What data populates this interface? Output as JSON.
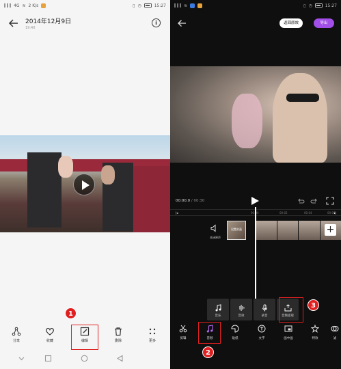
{
  "left": {
    "status": {
      "network": "4G",
      "speed": "2 K/s",
      "time": "15:27"
    },
    "header": {
      "date": "2014年12月9日",
      "time": "19:40"
    },
    "toolbar": [
      {
        "label": "分享",
        "icon": "share-icon"
      },
      {
        "label": "收藏",
        "icon": "heart-icon"
      },
      {
        "label": "编辑",
        "icon": "edit-icon"
      },
      {
        "label": "删除",
        "icon": "trash-icon"
      },
      {
        "label": "更多",
        "icon": "more-icon"
      }
    ],
    "step_marker": "1"
  },
  "right": {
    "status": {
      "time": "15:27"
    },
    "header": {
      "restore_label": "返回原效",
      "export_label": "导出"
    },
    "timecode": {
      "current": "00:00.0",
      "separator": " / ",
      "total": "00:30"
    },
    "ruler": [
      "00:00",
      "00:02",
      "00:04",
      "00:06"
    ],
    "track": {
      "mute_label": "关闭原声",
      "cover_label": "设置封面"
    },
    "sub_tools": [
      {
        "label": "音乐",
        "icon": "music-note-icon"
      },
      {
        "label": "音效",
        "icon": "waveform-icon"
      },
      {
        "label": "录音",
        "icon": "microphone-icon"
      },
      {
        "label": "音频提取",
        "icon": "extract-audio-icon"
      }
    ],
    "toolbar": [
      {
        "label": "剪辑",
        "icon": "scissors-icon"
      },
      {
        "label": "音频",
        "icon": "music-icon"
      },
      {
        "label": "贴纸",
        "icon": "sticker-icon"
      },
      {
        "label": "文字",
        "icon": "text-icon"
      },
      {
        "label": "画中画",
        "icon": "pip-icon"
      },
      {
        "label": "特效",
        "icon": "effects-icon"
      },
      {
        "label": "滤",
        "icon": "filter-icon"
      }
    ],
    "step_markers": [
      "2",
      "3"
    ]
  }
}
